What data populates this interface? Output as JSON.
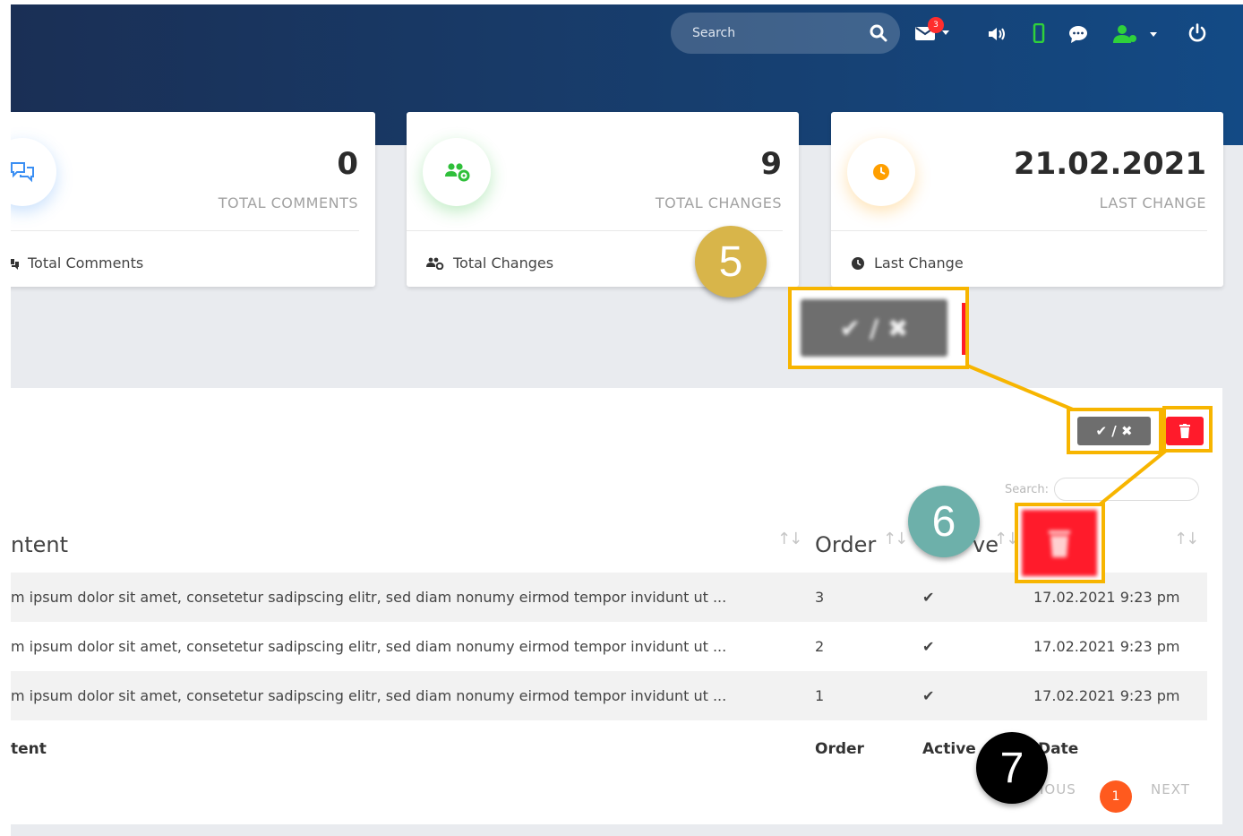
{
  "header": {
    "search_placeholder": "Search",
    "notification_count": "3"
  },
  "cards": [
    {
      "value": "0",
      "caption": "TOTAL COMMENTS",
      "footer": "Total Comments",
      "icon": "comments-icon",
      "color": "#3b8ff3"
    },
    {
      "value": "9",
      "caption": "TOTAL CHANGES",
      "footer": "Total Changes",
      "icon": "users-cog-icon",
      "color": "#2fbf3a"
    },
    {
      "value": "21.02.2021",
      "caption": "LAST CHANGE",
      "footer": "Last Change",
      "icon": "clock-icon",
      "color": "#ff9f00"
    }
  ],
  "toolbar": {
    "toggle_label": "✔ / ✖",
    "search_label": "Search:"
  },
  "table": {
    "headers": [
      "ntent",
      "Order",
      "ve",
      ""
    ],
    "rows": [
      {
        "content": "m ipsum dolor sit amet, consetetur sadipscing elitr, sed diam nonumy eirmod tempor invidunt ut ...",
        "order": "3",
        "active": "✔",
        "date": "17.02.2021 9:23 pm"
      },
      {
        "content": "m ipsum dolor sit amet, consetetur sadipscing elitr, sed diam nonumy eirmod tempor invidunt ut ...",
        "order": "2",
        "active": "✔",
        "date": "17.02.2021 9:23 pm"
      },
      {
        "content": "m ipsum dolor sit amet, consetetur sadipscing elitr, sed diam nonumy eirmod tempor invidunt ut ...",
        "order": "1",
        "active": "✔",
        "date": "17.02.2021 9:23 pm"
      }
    ],
    "footer": [
      "tent",
      "Order",
      "Active",
      "Date"
    ]
  },
  "pagination": {
    "previous": "IOUS",
    "current": "1",
    "next": "NEXT"
  },
  "annotations": {
    "zoom_toggle_label": "✔ / ✖",
    "marker_5": "5",
    "marker_6": "6",
    "marker_7": "7"
  },
  "colors": {
    "highlight": "#f7b500",
    "danger": "#ff1b2b",
    "pager_active": "#ff5a1e"
  }
}
